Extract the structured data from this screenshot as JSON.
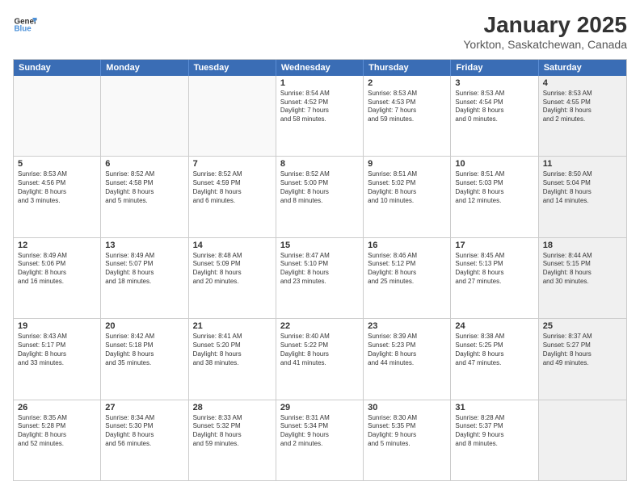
{
  "header": {
    "logo_line1": "General",
    "logo_line2": "Blue",
    "title": "January 2025",
    "subtitle": "Yorkton, Saskatchewan, Canada"
  },
  "calendar": {
    "days_of_week": [
      "Sunday",
      "Monday",
      "Tuesday",
      "Wednesday",
      "Thursday",
      "Friday",
      "Saturday"
    ],
    "rows": [
      [
        {
          "day": "",
          "text": "",
          "empty": true
        },
        {
          "day": "",
          "text": "",
          "empty": true
        },
        {
          "day": "",
          "text": "",
          "empty": true
        },
        {
          "day": "1",
          "text": "Sunrise: 8:54 AM\nSunset: 4:52 PM\nDaylight: 7 hours\nand 58 minutes."
        },
        {
          "day": "2",
          "text": "Sunrise: 8:53 AM\nSunset: 4:53 PM\nDaylight: 7 hours\nand 59 minutes."
        },
        {
          "day": "3",
          "text": "Sunrise: 8:53 AM\nSunset: 4:54 PM\nDaylight: 8 hours\nand 0 minutes."
        },
        {
          "day": "4",
          "text": "Sunrise: 8:53 AM\nSunset: 4:55 PM\nDaylight: 8 hours\nand 2 minutes.",
          "shaded": true
        }
      ],
      [
        {
          "day": "5",
          "text": "Sunrise: 8:53 AM\nSunset: 4:56 PM\nDaylight: 8 hours\nand 3 minutes."
        },
        {
          "day": "6",
          "text": "Sunrise: 8:52 AM\nSunset: 4:58 PM\nDaylight: 8 hours\nand 5 minutes."
        },
        {
          "day": "7",
          "text": "Sunrise: 8:52 AM\nSunset: 4:59 PM\nDaylight: 8 hours\nand 6 minutes."
        },
        {
          "day": "8",
          "text": "Sunrise: 8:52 AM\nSunset: 5:00 PM\nDaylight: 8 hours\nand 8 minutes."
        },
        {
          "day": "9",
          "text": "Sunrise: 8:51 AM\nSunset: 5:02 PM\nDaylight: 8 hours\nand 10 minutes."
        },
        {
          "day": "10",
          "text": "Sunrise: 8:51 AM\nSunset: 5:03 PM\nDaylight: 8 hours\nand 12 minutes."
        },
        {
          "day": "11",
          "text": "Sunrise: 8:50 AM\nSunset: 5:04 PM\nDaylight: 8 hours\nand 14 minutes.",
          "shaded": true
        }
      ],
      [
        {
          "day": "12",
          "text": "Sunrise: 8:49 AM\nSunset: 5:06 PM\nDaylight: 8 hours\nand 16 minutes."
        },
        {
          "day": "13",
          "text": "Sunrise: 8:49 AM\nSunset: 5:07 PM\nDaylight: 8 hours\nand 18 minutes."
        },
        {
          "day": "14",
          "text": "Sunrise: 8:48 AM\nSunset: 5:09 PM\nDaylight: 8 hours\nand 20 minutes."
        },
        {
          "day": "15",
          "text": "Sunrise: 8:47 AM\nSunset: 5:10 PM\nDaylight: 8 hours\nand 23 minutes."
        },
        {
          "day": "16",
          "text": "Sunrise: 8:46 AM\nSunset: 5:12 PM\nDaylight: 8 hours\nand 25 minutes."
        },
        {
          "day": "17",
          "text": "Sunrise: 8:45 AM\nSunset: 5:13 PM\nDaylight: 8 hours\nand 27 minutes."
        },
        {
          "day": "18",
          "text": "Sunrise: 8:44 AM\nSunset: 5:15 PM\nDaylight: 8 hours\nand 30 minutes.",
          "shaded": true
        }
      ],
      [
        {
          "day": "19",
          "text": "Sunrise: 8:43 AM\nSunset: 5:17 PM\nDaylight: 8 hours\nand 33 minutes."
        },
        {
          "day": "20",
          "text": "Sunrise: 8:42 AM\nSunset: 5:18 PM\nDaylight: 8 hours\nand 35 minutes."
        },
        {
          "day": "21",
          "text": "Sunrise: 8:41 AM\nSunset: 5:20 PM\nDaylight: 8 hours\nand 38 minutes."
        },
        {
          "day": "22",
          "text": "Sunrise: 8:40 AM\nSunset: 5:22 PM\nDaylight: 8 hours\nand 41 minutes."
        },
        {
          "day": "23",
          "text": "Sunrise: 8:39 AM\nSunset: 5:23 PM\nDaylight: 8 hours\nand 44 minutes."
        },
        {
          "day": "24",
          "text": "Sunrise: 8:38 AM\nSunset: 5:25 PM\nDaylight: 8 hours\nand 47 minutes."
        },
        {
          "day": "25",
          "text": "Sunrise: 8:37 AM\nSunset: 5:27 PM\nDaylight: 8 hours\nand 49 minutes.",
          "shaded": true
        }
      ],
      [
        {
          "day": "26",
          "text": "Sunrise: 8:35 AM\nSunset: 5:28 PM\nDaylight: 8 hours\nand 52 minutes."
        },
        {
          "day": "27",
          "text": "Sunrise: 8:34 AM\nSunset: 5:30 PM\nDaylight: 8 hours\nand 56 minutes."
        },
        {
          "day": "28",
          "text": "Sunrise: 8:33 AM\nSunset: 5:32 PM\nDaylight: 8 hours\nand 59 minutes."
        },
        {
          "day": "29",
          "text": "Sunrise: 8:31 AM\nSunset: 5:34 PM\nDaylight: 9 hours\nand 2 minutes."
        },
        {
          "day": "30",
          "text": "Sunrise: 8:30 AM\nSunset: 5:35 PM\nDaylight: 9 hours\nand 5 minutes."
        },
        {
          "day": "31",
          "text": "Sunrise: 8:28 AM\nSunset: 5:37 PM\nDaylight: 9 hours\nand 8 minutes."
        },
        {
          "day": "",
          "text": "",
          "empty": true,
          "shaded": true
        }
      ]
    ]
  }
}
